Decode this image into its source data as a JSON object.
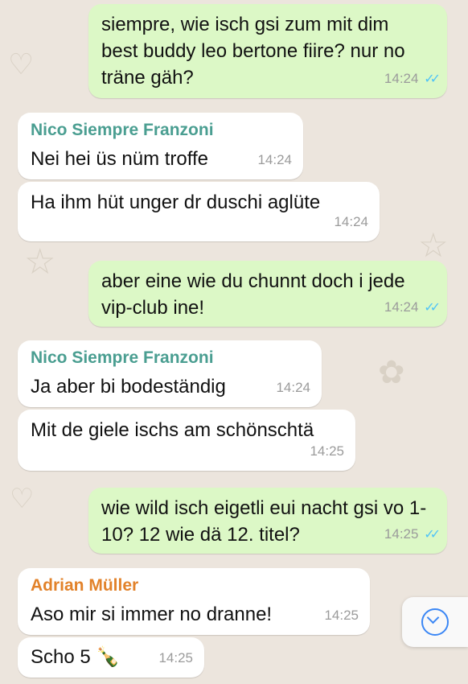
{
  "colors": {
    "wallpaper": "#ece5dd",
    "incoming_bubble": "#ffffff",
    "outgoing_bubble": "#dcf8c6",
    "sender_nico": "#4a9e91",
    "sender_adrian": "#e2822a",
    "read_ticks": "#4fc3f7",
    "scroll_button_accent": "#3b87f5"
  },
  "messages": [
    {
      "direction": "out",
      "text": "siempre, wie isch gsi zum mit dim best buddy leo bertone fiire? nur no träne gäh?",
      "time": "14:24",
      "status": "read"
    },
    {
      "direction": "in",
      "sender": "Nico Siempre Franzoni",
      "text": "Nei hei üs nüm troffe",
      "time": "14:24"
    },
    {
      "direction": "in",
      "text": "Ha ihm hüt unger dr duschi aglüte",
      "time": "14:24"
    },
    {
      "direction": "out",
      "text": "aber eine wie du chunnt doch i jede vip-club ine!",
      "time": "14:24",
      "status": "read"
    },
    {
      "direction": "in",
      "sender": "Nico Siempre Franzoni",
      "text": "Ja aber bi bodeständig",
      "time": "14:24"
    },
    {
      "direction": "in",
      "text": "Mit de giele ischs am schönschtä",
      "time": "14:25"
    },
    {
      "direction": "out",
      "text": "wie wild isch eigetli eui nacht gsi vo 1-10? 12 wie dä 12. titel?",
      "time": "14:25",
      "status": "read"
    },
    {
      "direction": "in",
      "sender": "Adrian Müller",
      "text": "Aso mir si immer no dranne!",
      "time": "14:25"
    },
    {
      "direction": "in",
      "text": "Scho 5 🍾",
      "time": "14:25"
    }
  ],
  "read_ticks_glyph": "✓✓",
  "scroll_button_icon": "chevron-down-icon"
}
